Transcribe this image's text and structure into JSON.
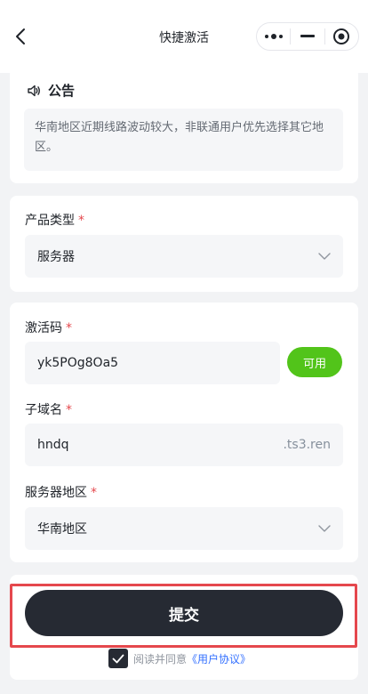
{
  "navbar": {
    "title": "快捷激活"
  },
  "notice": {
    "title": "公告",
    "text": "华南地区近期线路波动较大，非联通用户优先选择其它地区。"
  },
  "product_type": {
    "label": "产品类型",
    "required_mark": "*",
    "selected": "服务器"
  },
  "activation_code": {
    "label": "激活码",
    "required_mark": "*",
    "value": "yk5POg8Oa5",
    "status_button": "可用"
  },
  "subdomain": {
    "label": "子域名",
    "required_mark": "*",
    "value": "hndq",
    "suffix": ".ts3.ren"
  },
  "server_region": {
    "label": "服务器地区",
    "required_mark": "*",
    "selected": "华南地区"
  },
  "submit": {
    "label": "提交"
  },
  "agreement": {
    "text": "阅读并同意",
    "link": "《用户协议》",
    "checked": true
  },
  "colors": {
    "accent_dark": "#262a33",
    "available_green": "#52c41a",
    "required_red": "#e5484d",
    "link_blue": "#3370ff",
    "highlight_red": "#e5484d"
  },
  "icons": {
    "back": "chevron-left-icon",
    "more": "more-dots-icon",
    "minimize": "minus-icon",
    "close": "target-icon",
    "notice": "speaker-icon",
    "dropdown": "chevron-down-icon",
    "check": "check-icon"
  }
}
